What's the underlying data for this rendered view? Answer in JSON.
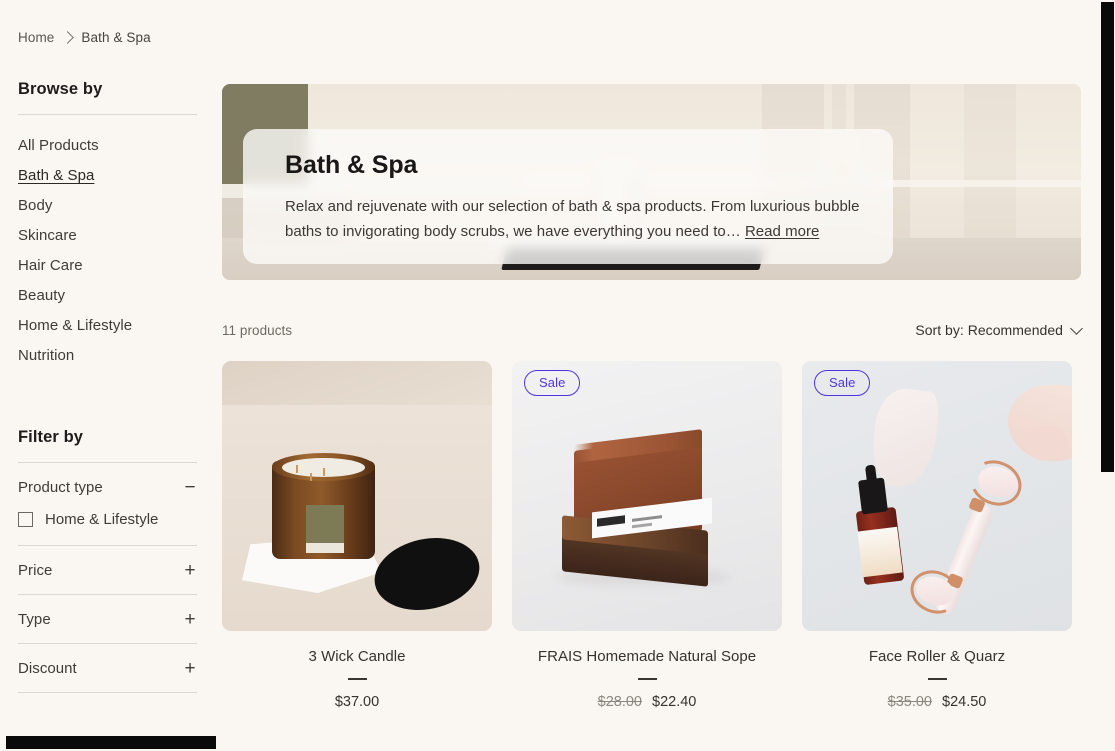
{
  "breadcrumb": {
    "home": "Home",
    "separator_icon": "chevron-right-icon",
    "current": "Bath & Spa"
  },
  "sidebar": {
    "browse_heading": "Browse by",
    "browse_items": [
      {
        "label": "All Products",
        "active": false
      },
      {
        "label": "Bath & Spa",
        "active": true
      },
      {
        "label": "Body",
        "active": false
      },
      {
        "label": "Skincare",
        "active": false
      },
      {
        "label": "Hair Care",
        "active": false
      },
      {
        "label": "Beauty",
        "active": false
      },
      {
        "label": "Home & Lifestyle",
        "active": false
      },
      {
        "label": "Nutrition",
        "active": false
      }
    ],
    "filter_heading": "Filter by",
    "filter_groups": [
      {
        "label": "Product type",
        "toggle_glyph": "−",
        "toggle_icon": "minus-icon",
        "expanded": true,
        "options": [
          {
            "label": "Home & Lifestyle",
            "checked": false
          }
        ]
      },
      {
        "label": "Price",
        "toggle_glyph": "+",
        "toggle_icon": "plus-icon",
        "expanded": false,
        "options": []
      },
      {
        "label": "Type",
        "toggle_glyph": "+",
        "toggle_icon": "plus-icon",
        "expanded": false,
        "options": []
      },
      {
        "label": "Discount",
        "toggle_glyph": "+",
        "toggle_icon": "plus-icon",
        "expanded": false,
        "options": []
      }
    ]
  },
  "hero": {
    "title": "Bath & Spa",
    "description": "Relax and rejuvenate with our selection of bath & spa products. From luxurious bubble baths to invigorating body scrubs, we have everything you need to… ",
    "read_more": "Read more"
  },
  "toolbar": {
    "product_count": "11 products",
    "sort_label": "Sort by: Recommended",
    "sort_icon": "chevron-down-icon"
  },
  "products": [
    {
      "name": "3 Wick Candle",
      "price": "$37.00",
      "compare_at_price": "",
      "badge": "",
      "image_alt": "amber-3-wick-candle-jar-with-black-lid-on-marble"
    },
    {
      "name": "FRAIS Homemade Natural Sope",
      "price": "$22.40",
      "compare_at_price": "$28.00",
      "badge": "Sale",
      "image_alt": "two-stacked-handmade-soap-bars-with-frais-label"
    },
    {
      "name": "Face Roller & Quarz",
      "price": "$24.50",
      "compare_at_price": "$35.00",
      "badge": "Sale",
      "image_alt": "rose-quartz-face-roller-gua-sha-and-serum-bottle"
    }
  ],
  "colors": {
    "page_background": "#faf7f2",
    "sale_badge": "#4f35e0",
    "text_primary": "#35322f",
    "text_muted": "#6d6862",
    "rule": "#dcd7ce"
  }
}
